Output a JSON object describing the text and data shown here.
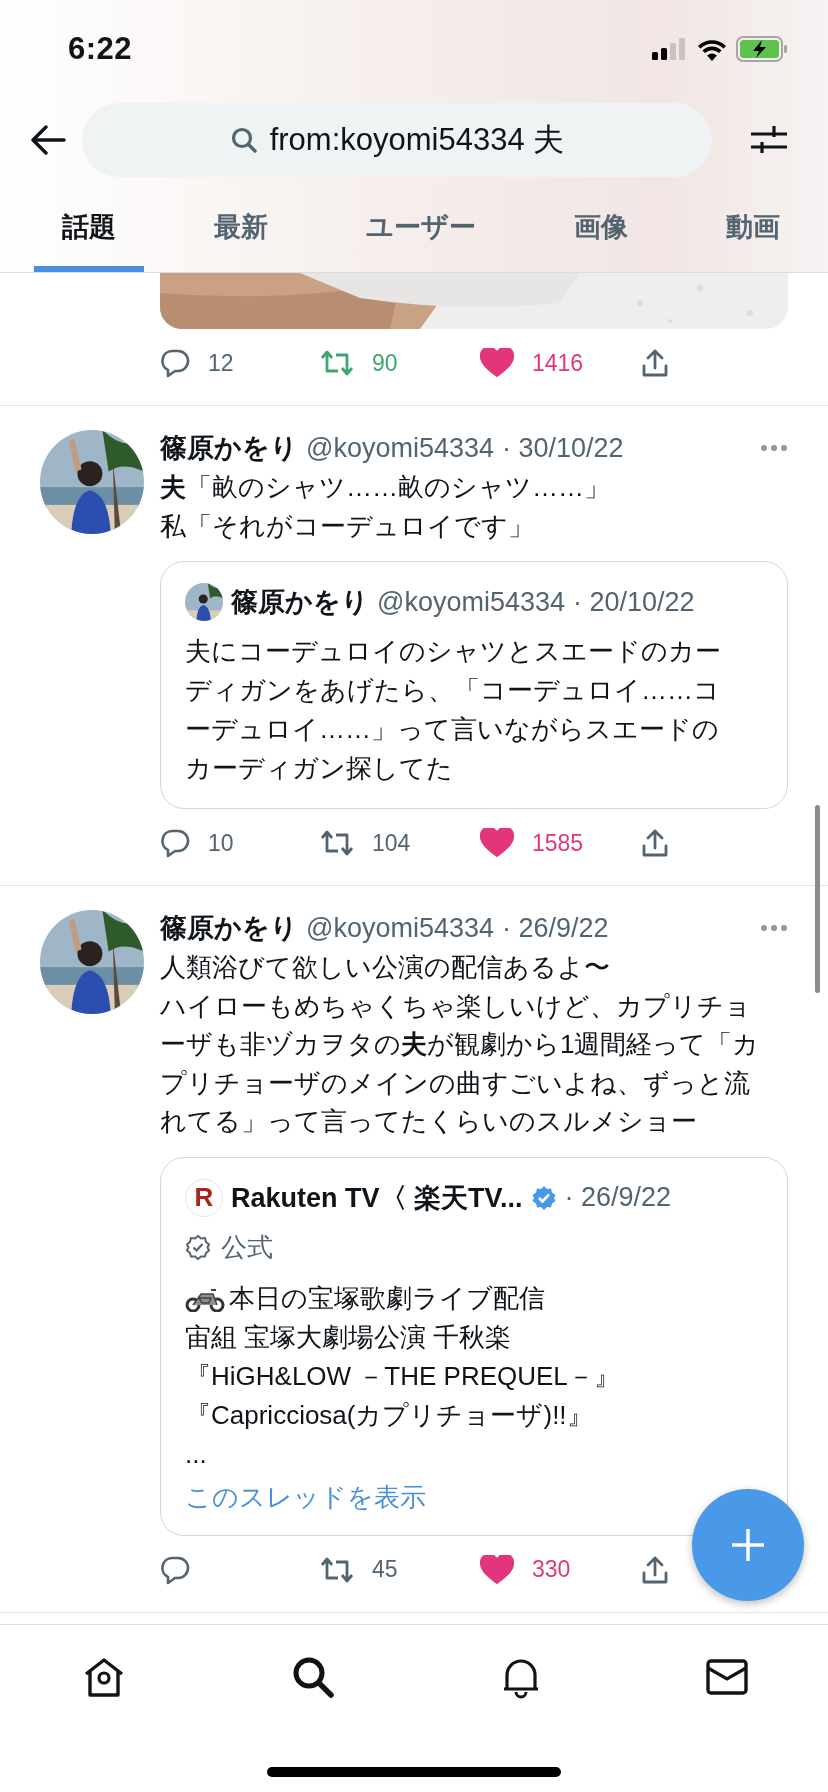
{
  "status_bar": {
    "time": "6:22"
  },
  "search": {
    "value": "from:koyomi54334 夫"
  },
  "tabs": [
    {
      "label": "話題",
      "selected": true
    },
    {
      "label": "最新",
      "selected": false
    },
    {
      "label": "ユーザー",
      "selected": false
    },
    {
      "label": "画像",
      "selected": false
    },
    {
      "label": "動画",
      "selected": false
    }
  ],
  "tweets": [
    {
      "kind": "media_tail",
      "actions": {
        "replies": "12",
        "retweets": "90",
        "likes": "1416",
        "retweeted": true,
        "liked": true
      }
    },
    {
      "kind": "quote_tweet",
      "name": "篠原かをり",
      "handle": "@koyomi54334",
      "date": "· 30/10/22",
      "lines": [
        "**夫**「畝のシャツ……畝のシャツ……」",
        "私「それがコーデュロイです」"
      ],
      "quote": {
        "kind": "tweet",
        "name": "篠原かをり",
        "handle": "@koyomi54334",
        "date": "· 20/10/22",
        "text": "夫にコーデュロイのシャツとスエードのカーディガンをあげたら、「コーデュロイ……コーデュロイ……」って言いながらスエードのカーディガン探してた"
      },
      "actions": {
        "replies": "10",
        "retweets": "104",
        "likes": "1585",
        "retweeted": false,
        "liked": true
      }
    },
    {
      "kind": "quote_tweet",
      "name": "篠原かをり",
      "handle": "@koyomi54334",
      "date": "· 26/9/22",
      "lines": [
        "人類浴びて欲しい公演の配信あるよ〜",
        "ハイローもめちゃくちゃ楽しいけど、カプリチョーザも非ヅカヲタの**夫**が観劇から1週間経って「カプリチョーザのメインの曲すごいよね、ずっと流れてる」って言ってたくらいのスルメショー"
      ],
      "quote": {
        "kind": "official",
        "logo_text": "R",
        "name": "Rakuten TV〈 楽天TV...",
        "verified": true,
        "date": "· 26/9/22",
        "label": "公式",
        "first_line": "本日の宝塚歌劇ライブ配信",
        "lines": [
          "宙組 宝塚大劇場公演 千秋楽",
          "『HiGH&LOW －THE PREQUEL－』",
          "『Capricciosa(カプリチョーザ)!!』",
          "..."
        ],
        "link": "このスレッドを表示"
      },
      "actions": {
        "retweets": "45",
        "likes": "330",
        "retweeted": false,
        "liked": true
      }
    }
  ]
}
